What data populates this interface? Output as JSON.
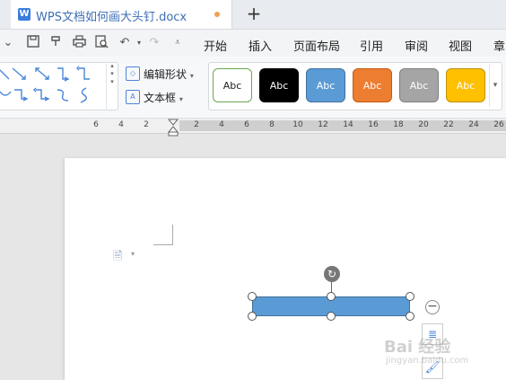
{
  "tab": {
    "icon": "W",
    "title": "WPS文档如何画大头钉.docx",
    "new_tab": "+"
  },
  "toolbar": {
    "icons": [
      "chevron-down-icon",
      "save-icon",
      "format-painter-icon",
      "print-icon",
      "print-preview-icon",
      "undo-icon",
      "redo-icon",
      "more-icon"
    ]
  },
  "menu": [
    "开始",
    "插入",
    "页面布局",
    "引用",
    "审阅",
    "视图",
    "章"
  ],
  "ribbon": {
    "edit_shape": "编辑形状",
    "text_frame": "文本框",
    "style_label": "Abc",
    "styles": [
      {
        "fill": "#ffffff",
        "border": "#6aa84f",
        "text": "#222222"
      },
      {
        "fill": "#000000",
        "border": "#000000",
        "text": "#ffffff"
      },
      {
        "fill": "#5b9bd5",
        "border": "#41719c",
        "text": "#ffffff"
      },
      {
        "fill": "#ed7d31",
        "border": "#c55a11",
        "text": "#ffffff"
      },
      {
        "fill": "#a5a5a5",
        "border": "#7f7f7f",
        "text": "#ffffff"
      },
      {
        "fill": "#ffc000",
        "border": "#bf9000",
        "text": "#ffffff"
      }
    ]
  },
  "ruler": {
    "numbers": [
      "6",
      "4",
      "2",
      "2",
      "4",
      "6",
      "8",
      "10",
      "12",
      "14",
      "16",
      "18",
      "20",
      "22",
      "24",
      "26"
    ]
  },
  "shape": {
    "fill": "#5b9bd5"
  },
  "watermark": {
    "main": "Bai 经验",
    "sub": "jingyan.baidu.com"
  }
}
